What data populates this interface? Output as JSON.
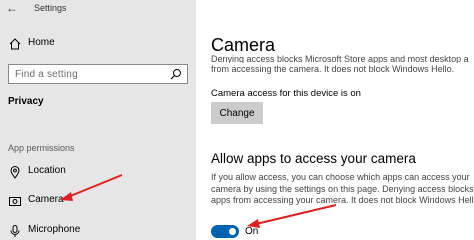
{
  "window": {
    "app_title": "Settings",
    "back_glyph": "←"
  },
  "sidebar": {
    "home_label": "Home",
    "search_placeholder": "Find a setting",
    "section_title": "Privacy",
    "group_label": "App permissions",
    "items": [
      {
        "label": "Location",
        "icon": "location-icon"
      },
      {
        "label": "Camera",
        "icon": "camera-icon"
      },
      {
        "label": "Microphone",
        "icon": "microphone-icon"
      }
    ]
  },
  "main": {
    "title": "Camera",
    "cut_off_text": "Denying access blocks Microsoft Store apps and most desktop apps",
    "intro_line": "from accessing the camera. It does not block Windows Hello.",
    "device_status": "Camera access for this device is on",
    "change_button": "Change",
    "allow_title": "Allow apps to access your camera",
    "allow_text": [
      "If you allow access, you can choose which apps can access your",
      "camera by using the settings on this page. Denying access blocks",
      "apps from accessing your camera. It does not block Windows Hello."
    ],
    "toggle_state": "On"
  },
  "colors": {
    "accent": "#0063b1",
    "annotation": "#e02020",
    "sidebar_bg": "#e6e6e6"
  }
}
